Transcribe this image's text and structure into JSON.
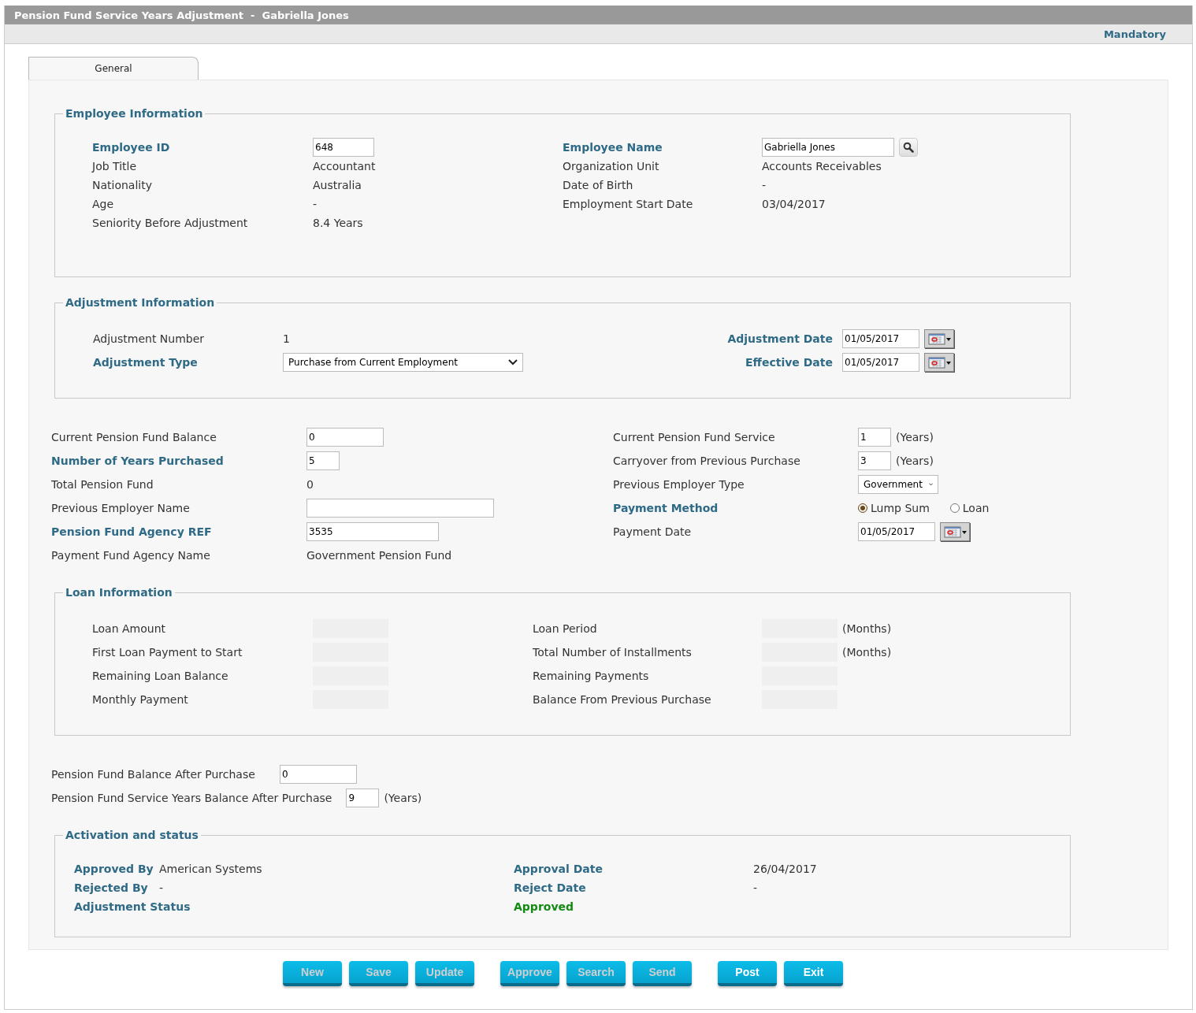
{
  "window": {
    "title": "Pension Fund Service Years Adjustment  -  Gabriella Jones"
  },
  "header": {
    "mandatory_label": "Mandatory"
  },
  "tabs": [
    {
      "label": "General",
      "selected": true
    }
  ],
  "sections": [
    {
      "kind": "fieldset",
      "legend": "Employee Information",
      "rows": [
        {
          "cells": [
            {
              "kind": "label",
              "text": "Employee ID",
              "required": true
            },
            {
              "kind": "input",
              "value": "648"
            },
            {
              "kind": "label",
              "text": "Employee Name",
              "required": true
            },
            {
              "kind": "search-input",
              "value": "Gabriella Jones"
            }
          ]
        },
        {
          "cells": [
            {
              "kind": "label",
              "text": "Job Title",
              "required": false
            },
            {
              "kind": "text",
              "text": "Accountant"
            },
            {
              "kind": "label",
              "text": "Organization Unit",
              "required": false
            },
            {
              "kind": "text",
              "text": "Accounts Receivables"
            }
          ]
        },
        {
          "cells": [
            {
              "kind": "label",
              "text": "Nationality",
              "required": false
            },
            {
              "kind": "text",
              "text": "Australia"
            },
            {
              "kind": "label",
              "text": "Date of Birth",
              "required": false
            },
            {
              "kind": "text",
              "text": "-"
            }
          ]
        },
        {
          "cells": [
            {
              "kind": "label",
              "text": "Age",
              "required": false
            },
            {
              "kind": "text",
              "text": "-"
            },
            {
              "kind": "label",
              "text": "Employment Start Date",
              "required": false
            },
            {
              "kind": "text",
              "text": "03/04/2017"
            }
          ]
        },
        {
          "cells": [
            {
              "kind": "label",
              "text": "Seniority Before Adjustment",
              "required": false
            },
            {
              "kind": "text",
              "text": "8.4 Years"
            }
          ]
        }
      ]
    },
    {
      "kind": "fieldset",
      "legend": "Adjustment Information",
      "rows": [
        {
          "cells": [
            {
              "kind": "label",
              "text": "Adjustment Number",
              "required": false
            },
            {
              "kind": "text",
              "text": "1"
            },
            {
              "kind": "label",
              "text": "Adjustment Date",
              "required": true
            },
            {
              "kind": "date",
              "value": "01/05/2017"
            }
          ]
        },
        {
          "cells": [
            {
              "kind": "label",
              "text": "Adjustment Type",
              "required": true
            },
            {
              "kind": "select",
              "value": "Purchase from Current Employment"
            },
            {
              "kind": "label",
              "text": "Effective Date",
              "required": true
            },
            {
              "kind": "date",
              "value": "01/05/2017"
            }
          ]
        }
      ]
    },
    {
      "kind": "plain",
      "rows": [
        {
          "cells": [
            {
              "kind": "label",
              "text": "Current Pension Fund Balance",
              "required": false
            },
            {
              "kind": "input",
              "value": "0"
            },
            {
              "kind": "label",
              "text": "Current Pension Fund Service",
              "required": false
            },
            {
              "kind": "input",
              "value": "1",
              "unit": "(Years)"
            }
          ]
        },
        {
          "cells": [
            {
              "kind": "label",
              "text": "Number of Years Purchased",
              "required": true
            },
            {
              "kind": "input",
              "value": "5"
            },
            {
              "kind": "label",
              "text": "Carryover from Previous Purchase",
              "required": false
            },
            {
              "kind": "input",
              "value": "3",
              "unit": "(Years)"
            }
          ]
        },
        {
          "cells": [
            {
              "kind": "label",
              "text": "Total Pension Fund",
              "required": false
            },
            {
              "kind": "text",
              "text": "0"
            },
            {
              "kind": "label",
              "text": "Previous Employer Type",
              "required": false
            },
            {
              "kind": "select",
              "value": "Government"
            }
          ]
        },
        {
          "cells": [
            {
              "kind": "label",
              "text": "Previous Employer Name",
              "required": false
            },
            {
              "kind": "input"
            },
            {
              "kind": "label",
              "text": "Payment Method",
              "required": true
            },
            {
              "kind": "radio",
              "options": [
                {
                  "label": "Lump Sum",
                  "selected": true
                },
                {
                  "label": "Loan",
                  "selected": false
                }
              ]
            }
          ]
        },
        {
          "cells": [
            {
              "kind": "label",
              "text": "Pension Fund Agency REF",
              "required": true
            },
            {
              "kind": "input",
              "value": "3535"
            },
            {
              "kind": "label",
              "text": "Payment Date",
              "required": false
            },
            {
              "kind": "date",
              "value": "01/05/2017"
            }
          ]
        },
        {
          "cells": [
            {
              "kind": "label",
              "text": "Payment Fund Agency Name",
              "required": false
            },
            {
              "kind": "text",
              "text": "Government Pension Fund"
            }
          ]
        }
      ]
    },
    {
      "kind": "fieldset",
      "legend": "Loan Information",
      "rows": [
        {
          "cells": [
            {
              "kind": "label",
              "text": "Loan Amount",
              "required": false
            },
            {
              "kind": "disabled-input"
            },
            {
              "kind": "label",
              "text": "Loan Period",
              "required": false
            },
            {
              "kind": "disabled-input",
              "unit": "(Months)"
            }
          ]
        },
        {
          "cells": [
            {
              "kind": "label",
              "text": "First Loan Payment to Start",
              "required": false
            },
            {
              "kind": "disabled-input"
            },
            {
              "kind": "label",
              "text": "Total Number of Installments",
              "required": false
            },
            {
              "kind": "disabled-input",
              "unit": "(Months)"
            }
          ]
        },
        {
          "cells": [
            {
              "kind": "label",
              "text": "Remaining Loan Balance",
              "required": false
            },
            {
              "kind": "disabled-input"
            },
            {
              "kind": "label",
              "text": "Remaining Payments",
              "required": false
            },
            {
              "kind": "disabled-input"
            }
          ]
        },
        {
          "cells": [
            {
              "kind": "label",
              "text": "Monthly Payment",
              "required": false
            },
            {
              "kind": "disabled-input"
            },
            {
              "kind": "label",
              "text": "Balance From Previous Purchase",
              "required": false
            },
            {
              "kind": "disabled-input"
            }
          ]
        }
      ]
    },
    {
      "kind": "plain",
      "rows": [
        {
          "cells": [
            {
              "kind": "label",
              "text": "Pension Fund Balance After Purchase",
              "required": false
            },
            {
              "kind": "input",
              "value": "0"
            }
          ]
        }
      ]
    },
    {
      "kind": "plain",
      "rows": [
        {
          "cells": [
            {
              "kind": "label",
              "text": "Pension Fund Service Years Balance After Purchase",
              "required": false
            },
            {
              "kind": "input",
              "value": "9",
              "unit": "(Years)"
            }
          ]
        }
      ]
    },
    {
      "kind": "fieldset",
      "legend": "Activation and status",
      "rows": [
        {
          "cells": [
            {
              "kind": "label",
              "text": "Approved By",
              "required": true
            },
            {
              "kind": "text",
              "text": "American Systems"
            },
            {
              "kind": "label",
              "text": "Approval Date",
              "required": true
            },
            {
              "kind": "text",
              "text": "26/04/2017"
            }
          ]
        },
        {
          "cells": [
            {
              "kind": "label",
              "text": "Rejected By",
              "required": true
            },
            {
              "kind": "text",
              "text": "-"
            },
            {
              "kind": "label",
              "text": "Reject Date",
              "required": true
            },
            {
              "kind": "text",
              "text": "-"
            }
          ]
        },
        {
          "cells": [
            {
              "kind": "label",
              "text": "Adjustment Status",
              "required": true
            },
            {
              "kind": "empty"
            },
            {
              "kind": "status",
              "text": "Approved"
            }
          ]
        }
      ]
    }
  ],
  "button_groups": [
    [
      {
        "label": "New",
        "disabled": true
      },
      {
        "label": "Save",
        "disabled": true
      },
      {
        "label": "Update",
        "disabled": true
      }
    ],
    [
      {
        "label": "Approve",
        "disabled": true
      },
      {
        "label": "Search",
        "disabled": true
      },
      {
        "label": "Send",
        "disabled": true
      }
    ],
    [
      {
        "label": "Post",
        "disabled": false
      },
      {
        "label": "Exit",
        "disabled": false
      }
    ]
  ]
}
